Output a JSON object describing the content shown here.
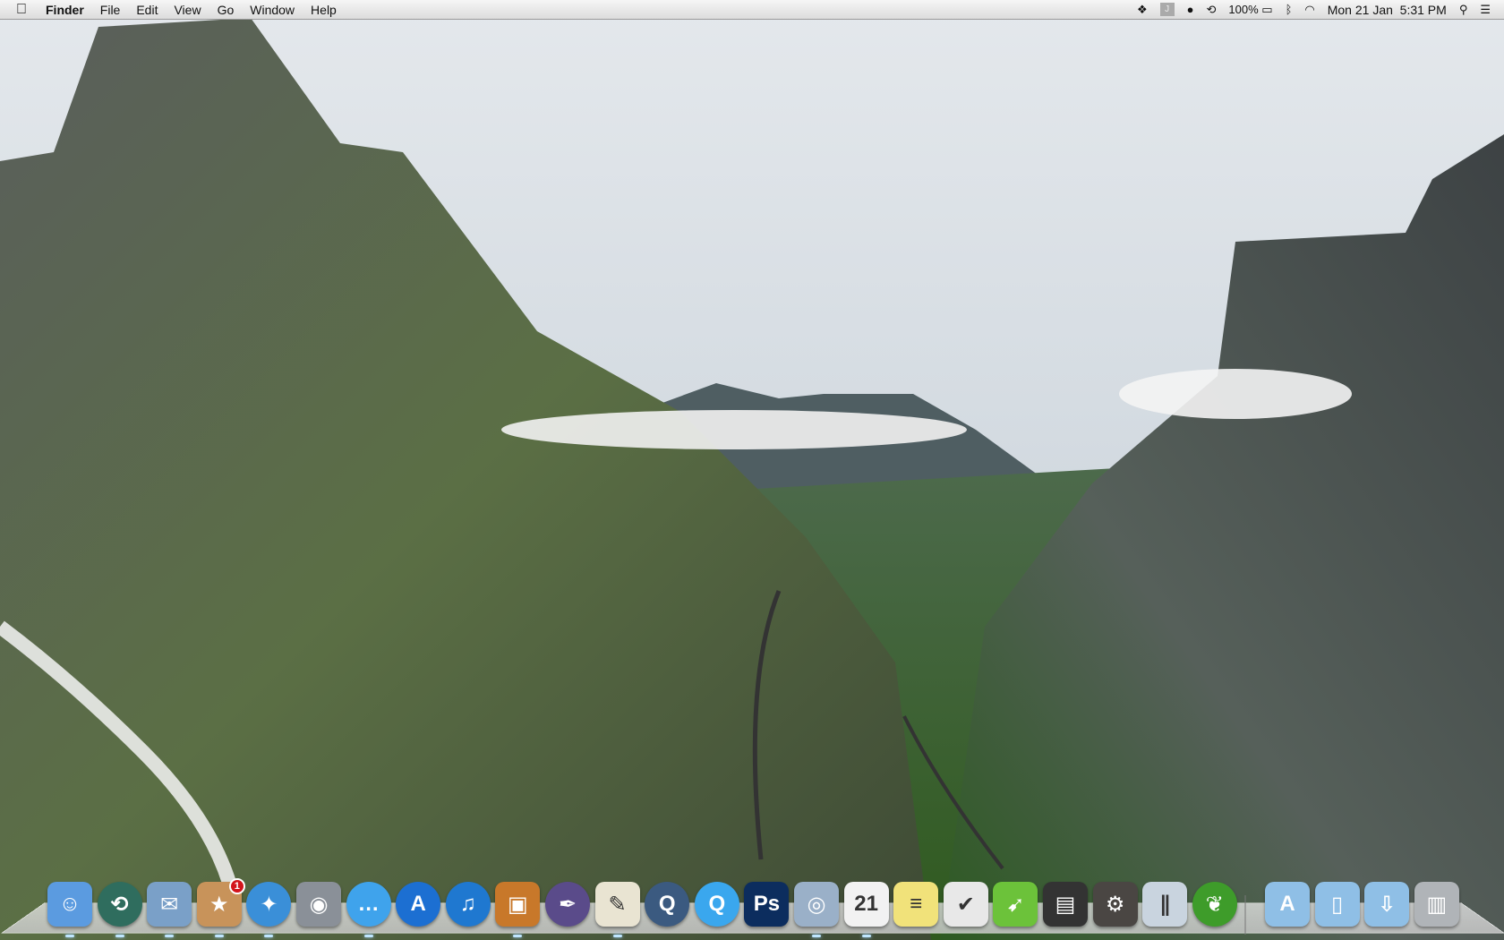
{
  "menubar": {
    "apple": "",
    "app": "Finder",
    "items": [
      "File",
      "Edit",
      "View",
      "Go",
      "Window",
      "Help"
    ],
    "status": {
      "dropbox": "dropbox-icon",
      "j": "J",
      "battery": "100%",
      "datetime": "Mon 21 Jan  5:31 PM"
    }
  },
  "dock": {
    "apps": [
      {
        "name": "Finder",
        "glyph": "☺",
        "color": "#5b9be0",
        "round": false,
        "running": true
      },
      {
        "name": "Time Machine",
        "glyph": "⟲",
        "color": "#2f6d5e",
        "round": true,
        "running": true
      },
      {
        "name": "Mail",
        "glyph": "✉",
        "color": "#7aa0c8",
        "round": false,
        "running": true
      },
      {
        "name": "Deliveries",
        "glyph": "★",
        "color": "#c8935a",
        "round": false,
        "running": true,
        "badge": "1"
      },
      {
        "name": "Safari",
        "glyph": "✦",
        "color": "#3a8fd8",
        "round": true,
        "running": true
      },
      {
        "name": "FaceTime",
        "glyph": "◉",
        "color": "#8a9098",
        "round": false,
        "running": false
      },
      {
        "name": "Messages",
        "glyph": "…",
        "color": "#3fa3ec",
        "round": true,
        "running": true
      },
      {
        "name": "App Store",
        "glyph": "A",
        "color": "#1c6fd2",
        "round": true,
        "running": false
      },
      {
        "name": "iTunes",
        "glyph": "♫",
        "color": "#1f78d0",
        "round": true,
        "running": false
      },
      {
        "name": "iPhoto",
        "glyph": "▣",
        "color": "#c8782a",
        "round": false,
        "running": true
      },
      {
        "name": "Script Editor",
        "glyph": "✒",
        "color": "#5a4b8a",
        "round": true,
        "running": false
      },
      {
        "name": "TextEdit",
        "glyph": "✎",
        "color": "#e9e4d2",
        "round": false,
        "running": true
      },
      {
        "name": "QuickTime Player",
        "glyph": "Q",
        "color": "#3b5a80",
        "round": true,
        "running": false
      },
      {
        "name": "QuickTime Player 7",
        "glyph": "Q",
        "color": "#3aa7ee",
        "round": true,
        "running": false
      },
      {
        "name": "Photoshop",
        "glyph": "Ps",
        "color": "#0c2d5e",
        "round": false,
        "running": false
      },
      {
        "name": "Preview",
        "glyph": "◎",
        "color": "#9ab0c8",
        "round": false,
        "running": true
      },
      {
        "name": "Calendar",
        "glyph": "21",
        "color": "#f2f2f2",
        "round": false,
        "running": true
      },
      {
        "name": "Stickies",
        "glyph": "≡",
        "color": "#f1e27a",
        "round": false,
        "running": false
      },
      {
        "name": "Reminders",
        "glyph": "✔",
        "color": "#e8e8e8",
        "round": false,
        "running": false
      },
      {
        "name": "Ray Gun App",
        "glyph": "➹",
        "color": "#6cc23a",
        "round": false,
        "running": false
      },
      {
        "name": "Clapper App",
        "glyph": "▤",
        "color": "#333333",
        "round": false,
        "running": false
      },
      {
        "name": "Steam",
        "glyph": "⚙",
        "color": "#4a4643",
        "round": false,
        "running": false
      },
      {
        "name": "Parallels Desktop",
        "glyph": "∥",
        "color": "#c9d4df",
        "round": false,
        "running": false
      },
      {
        "name": "Coda",
        "glyph": "❦",
        "color": "#3e9c2a",
        "round": true,
        "running": false
      }
    ],
    "stacks": [
      {
        "name": "Applications",
        "glyph": "A",
        "color": "#8fbfe6"
      },
      {
        "name": "Documents",
        "glyph": "▯",
        "color": "#8fbfe6"
      },
      {
        "name": "Downloads",
        "glyph": "⇩",
        "color": "#8fbfe6"
      },
      {
        "name": "Trash",
        "glyph": "▥",
        "color": "#b0b4b8"
      }
    ]
  }
}
